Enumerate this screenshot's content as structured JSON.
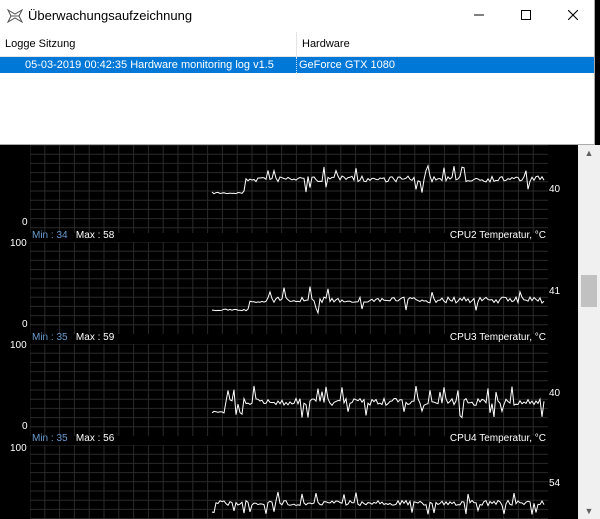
{
  "dialog": {
    "title": "Überwachungsaufzeichnung",
    "columns": {
      "session": "Logge Sitzung",
      "hardware": "Hardware"
    },
    "rows": [
      {
        "session": "05-03-2019 00:42:35 Hardware monitoring log v1.5",
        "hardware": "GeForce GTX 1080",
        "selected": true
      }
    ]
  },
  "graphs": [
    {
      "max_label": "",
      "min_label": "0",
      "current": "40",
      "title": "",
      "min_text": "",
      "max_text": ""
    },
    {
      "max_label": "100",
      "min_label": "0",
      "current": "41",
      "title": "CPU2 Temperatur, °C",
      "min_text": "Min : 34",
      "max_text": "Max : 58"
    },
    {
      "max_label": "100",
      "min_label": "0",
      "current": "40",
      "title": "CPU3 Temperatur, °C",
      "min_text": "Min : 35",
      "max_text": "Max : 59"
    },
    {
      "max_label": "100",
      "min_label": "",
      "current": "54",
      "title": "CPU4 Temperatur, °C",
      "min_text": "Min : 35",
      "max_text": "Max : 56"
    }
  ],
  "colors": {
    "selection": "#0078d7",
    "minmax_label": "#6a9bd0",
    "plot_line": "#ffffff",
    "grid": "#2a2a2a"
  },
  "icons": {
    "app": "monitor-app-icon",
    "minimize": "minimize-icon",
    "maximize": "maximize-icon",
    "close": "close-icon"
  }
}
